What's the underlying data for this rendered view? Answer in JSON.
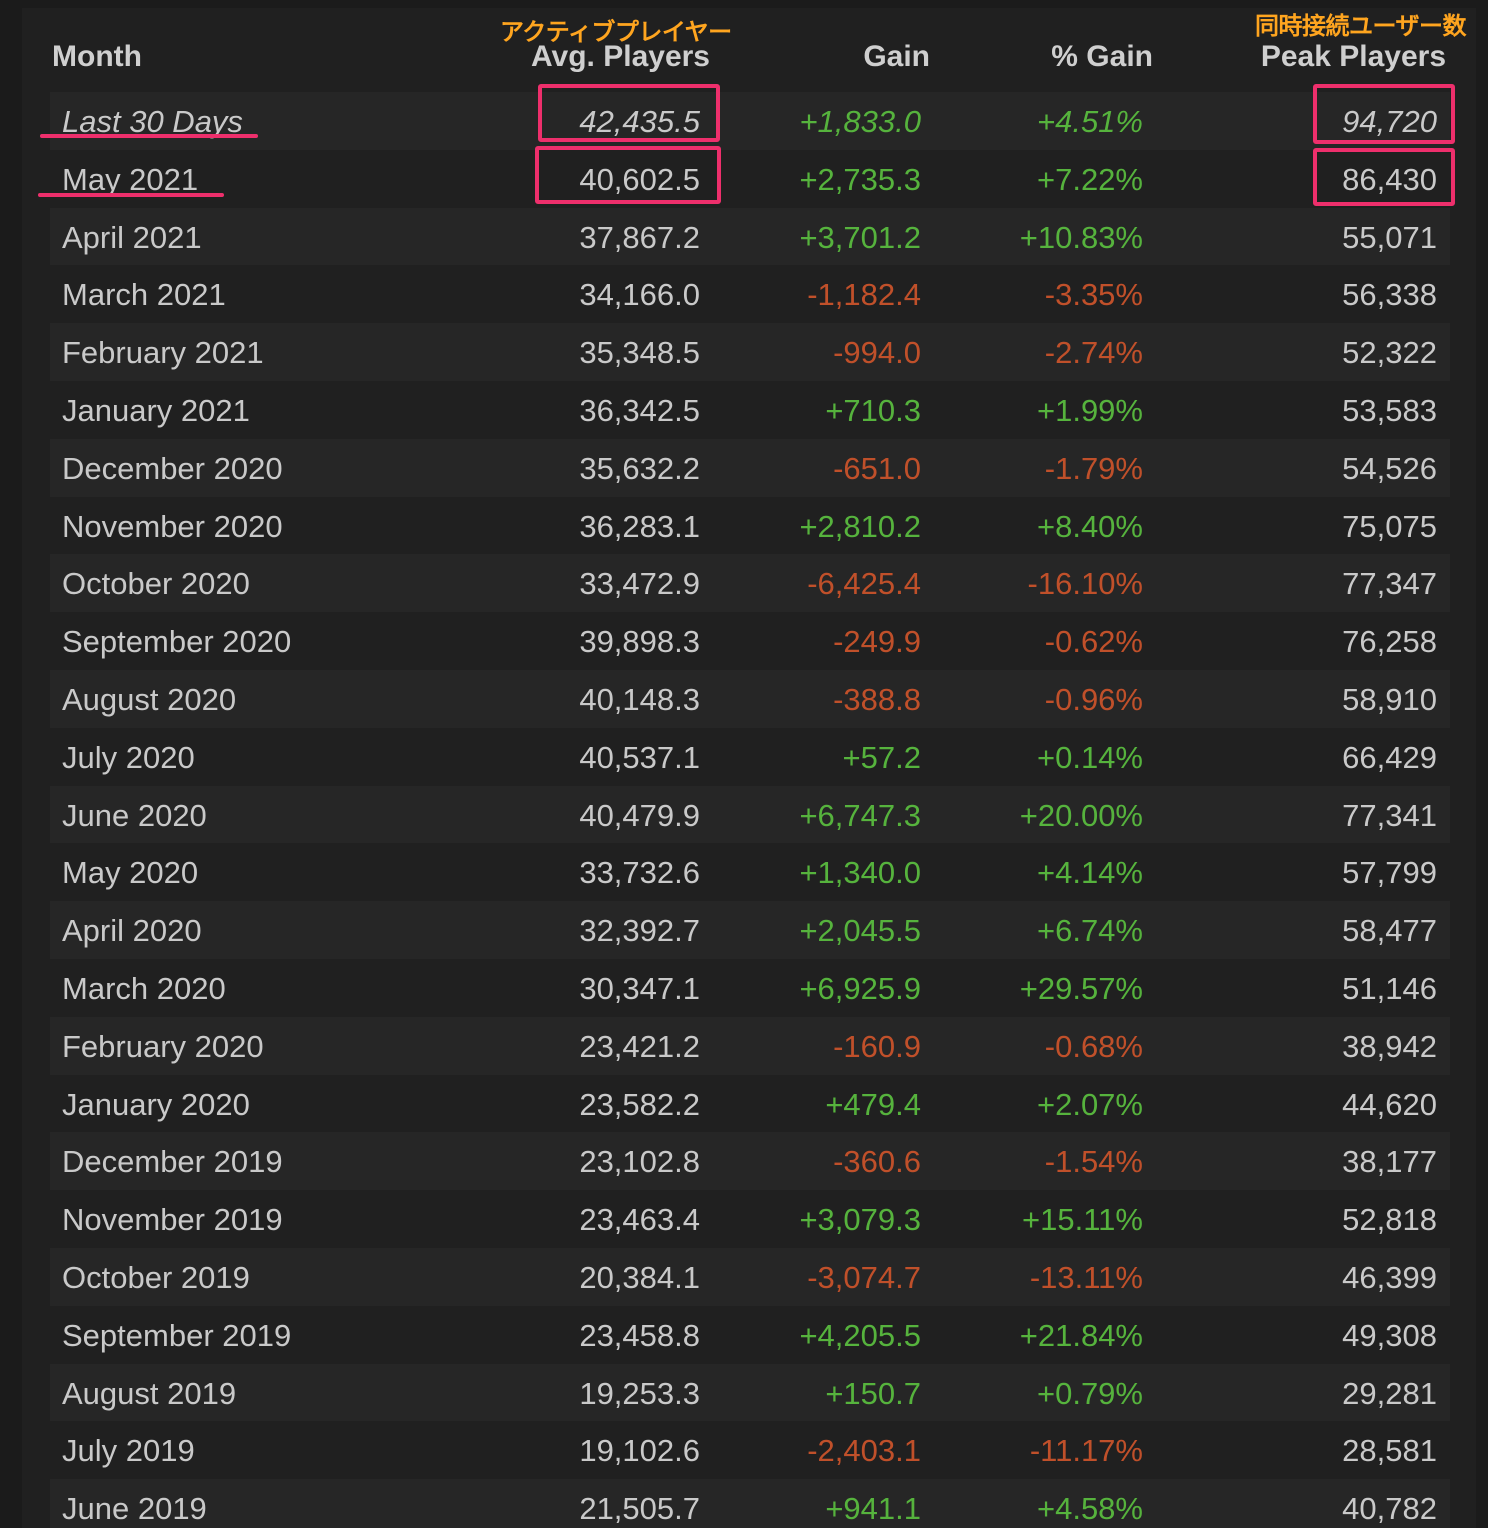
{
  "annotations": {
    "avg_players_jp": "アクティブプレイヤー",
    "peak_players_jp": "同時接続ユーザー数",
    "highlight_color": "#ee2f6c",
    "label_color": "#ffa51f"
  },
  "colors": {
    "positive": "#56b33d",
    "negative": "#c0502a",
    "text": "#c9c9c9",
    "background": "#202020"
  },
  "header": {
    "month": "Month",
    "avg_players": "Avg. Players",
    "gain": "Gain",
    "pct_gain": "% Gain",
    "peak_players": "Peak Players"
  },
  "rows": [
    {
      "month": "Last 30 Days",
      "avg": "42,435.5",
      "gain": "+1,833.0",
      "pct": "+4.51%",
      "peak": "94,720",
      "trend": "pos"
    },
    {
      "month": "May 2021",
      "avg": "40,602.5",
      "gain": "+2,735.3",
      "pct": "+7.22%",
      "peak": "86,430",
      "trend": "pos"
    },
    {
      "month": "April 2021",
      "avg": "37,867.2",
      "gain": "+3,701.2",
      "pct": "+10.83%",
      "peak": "55,071",
      "trend": "pos"
    },
    {
      "month": "March 2021",
      "avg": "34,166.0",
      "gain": "-1,182.4",
      "pct": "-3.35%",
      "peak": "56,338",
      "trend": "neg"
    },
    {
      "month": "February 2021",
      "avg": "35,348.5",
      "gain": "-994.0",
      "pct": "-2.74%",
      "peak": "52,322",
      "trend": "neg"
    },
    {
      "month": "January 2021",
      "avg": "36,342.5",
      "gain": "+710.3",
      "pct": "+1.99%",
      "peak": "53,583",
      "trend": "pos"
    },
    {
      "month": "December 2020",
      "avg": "35,632.2",
      "gain": "-651.0",
      "pct": "-1.79%",
      "peak": "54,526",
      "trend": "neg"
    },
    {
      "month": "November 2020",
      "avg": "36,283.1",
      "gain": "+2,810.2",
      "pct": "+8.40%",
      "peak": "75,075",
      "trend": "pos"
    },
    {
      "month": "October 2020",
      "avg": "33,472.9",
      "gain": "-6,425.4",
      "pct": "-16.10%",
      "peak": "77,347",
      "trend": "neg"
    },
    {
      "month": "September 2020",
      "avg": "39,898.3",
      "gain": "-249.9",
      "pct": "-0.62%",
      "peak": "76,258",
      "trend": "neg"
    },
    {
      "month": "August 2020",
      "avg": "40,148.3",
      "gain": "-388.8",
      "pct": "-0.96%",
      "peak": "58,910",
      "trend": "neg"
    },
    {
      "month": "July 2020",
      "avg": "40,537.1",
      "gain": "+57.2",
      "pct": "+0.14%",
      "peak": "66,429",
      "trend": "pos"
    },
    {
      "month": "June 2020",
      "avg": "40,479.9",
      "gain": "+6,747.3",
      "pct": "+20.00%",
      "peak": "77,341",
      "trend": "pos"
    },
    {
      "month": "May 2020",
      "avg": "33,732.6",
      "gain": "+1,340.0",
      "pct": "+4.14%",
      "peak": "57,799",
      "trend": "pos"
    },
    {
      "month": "April 2020",
      "avg": "32,392.7",
      "gain": "+2,045.5",
      "pct": "+6.74%",
      "peak": "58,477",
      "trend": "pos"
    },
    {
      "month": "March 2020",
      "avg": "30,347.1",
      "gain": "+6,925.9",
      "pct": "+29.57%",
      "peak": "51,146",
      "trend": "pos"
    },
    {
      "month": "February 2020",
      "avg": "23,421.2",
      "gain": "-160.9",
      "pct": "-0.68%",
      "peak": "38,942",
      "trend": "neg"
    },
    {
      "month": "January 2020",
      "avg": "23,582.2",
      "gain": "+479.4",
      "pct": "+2.07%",
      "peak": "44,620",
      "trend": "pos"
    },
    {
      "month": "December 2019",
      "avg": "23,102.8",
      "gain": "-360.6",
      "pct": "-1.54%",
      "peak": "38,177",
      "trend": "neg"
    },
    {
      "month": "November 2019",
      "avg": "23,463.4",
      "gain": "+3,079.3",
      "pct": "+15.11%",
      "peak": "52,818",
      "trend": "pos"
    },
    {
      "month": "October 2019",
      "avg": "20,384.1",
      "gain": "-3,074.7",
      "pct": "-13.11%",
      "peak": "46,399",
      "trend": "neg"
    },
    {
      "month": "September 2019",
      "avg": "23,458.8",
      "gain": "+4,205.5",
      "pct": "+21.84%",
      "peak": "49,308",
      "trend": "pos"
    },
    {
      "month": "August 2019",
      "avg": "19,253.3",
      "gain": "+150.7",
      "pct": "+0.79%",
      "peak": "29,281",
      "trend": "pos"
    },
    {
      "month": "July 2019",
      "avg": "19,102.6",
      "gain": "-2,403.1",
      "pct": "-11.17%",
      "peak": "28,581",
      "trend": "neg"
    },
    {
      "month": "June 2019",
      "avg": "21,505.7",
      "gain": "+941.1",
      "pct": "+4.58%",
      "peak": "40,782",
      "trend": "pos"
    }
  ]
}
